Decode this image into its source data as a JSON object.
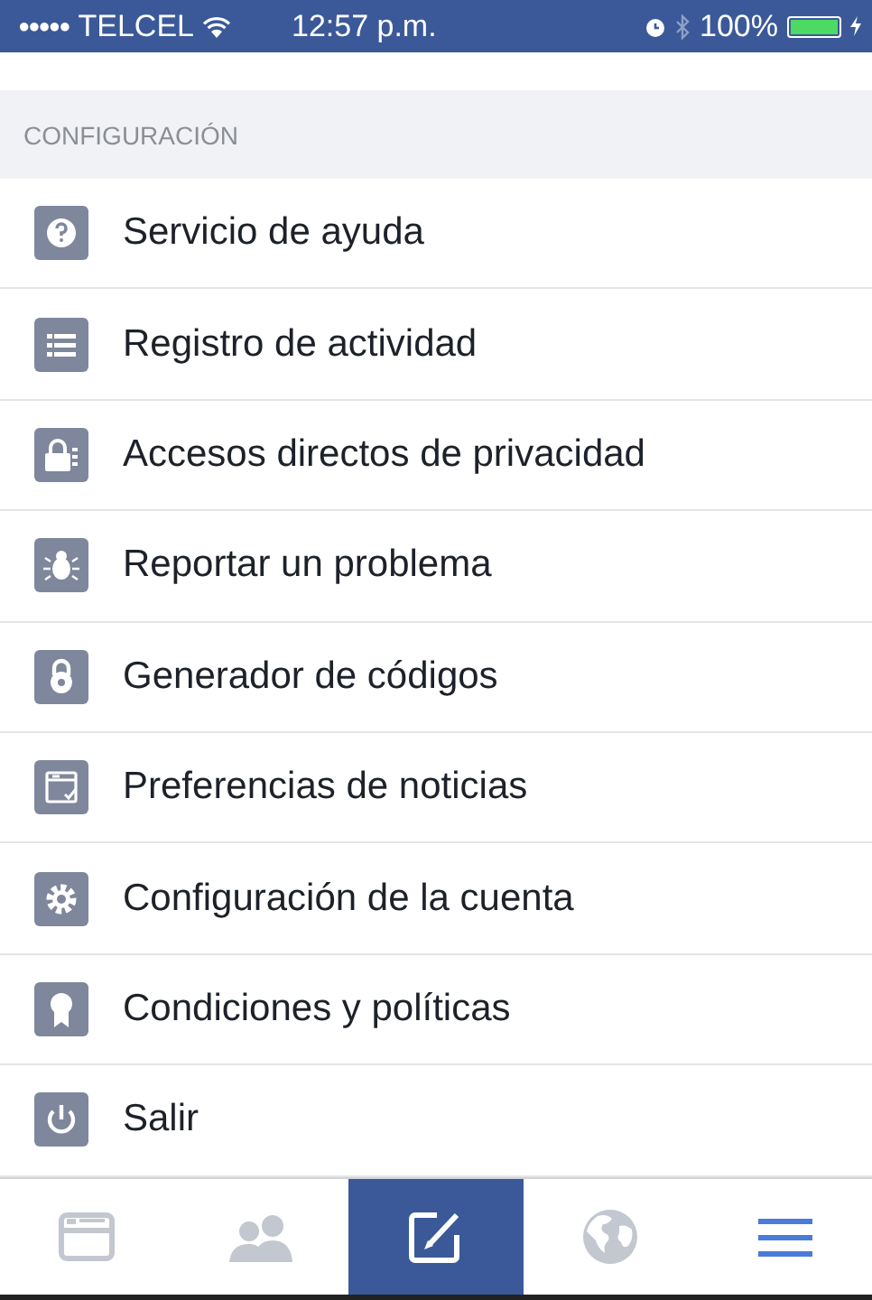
{
  "status_bar": {
    "signal_dots": "●●●●●",
    "carrier": "TELCEL",
    "time": "12:57 p.m.",
    "battery": "100%"
  },
  "section": {
    "title": "CONFIGURACIÓN"
  },
  "items": [
    {
      "kind": "help",
      "label": "Servicio de ayuda"
    },
    {
      "kind": "list",
      "label": "Registro de actividad"
    },
    {
      "kind": "lock",
      "label": "Accesos directos de privacidad"
    },
    {
      "kind": "bug",
      "label": "Reportar un problema"
    },
    {
      "kind": "padlock",
      "label": "Generador de códigos"
    },
    {
      "kind": "feed",
      "label": "Preferencias de noticias"
    },
    {
      "kind": "gear",
      "label": "Configuración de la cuenta"
    },
    {
      "kind": "ribbon",
      "label": "Condiciones y políticas"
    },
    {
      "kind": "power",
      "label": "Salir"
    }
  ],
  "tabs": [
    {
      "kind": "feed",
      "selected": false
    },
    {
      "kind": "friends",
      "selected": false
    },
    {
      "kind": "compose",
      "selected": false
    },
    {
      "kind": "globe",
      "selected": false
    },
    {
      "kind": "menu",
      "selected": true
    }
  ]
}
